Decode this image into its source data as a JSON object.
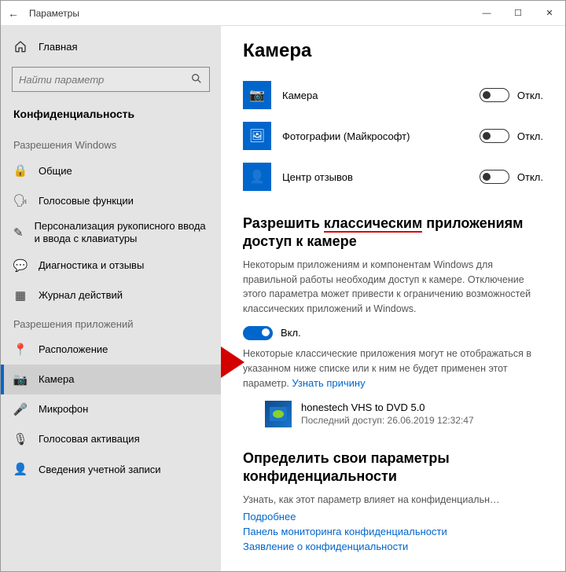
{
  "titlebar": {
    "title": "Параметры"
  },
  "sidebar": {
    "home": "Главная",
    "search_placeholder": "Найти параметр",
    "category": "Конфиденциальность",
    "sections": [
      {
        "header": "Разрешения Windows",
        "items": [
          {
            "icon": "lock-icon",
            "label": "Общие"
          },
          {
            "icon": "voice-icon",
            "label": "Голосовые функции"
          },
          {
            "icon": "pen-icon",
            "label": "Персонализация рукописного ввода и ввода с клавиатуры"
          },
          {
            "icon": "feedback-icon",
            "label": "Диагностика и отзывы"
          },
          {
            "icon": "activity-icon",
            "label": "Журнал действий"
          }
        ]
      },
      {
        "header": "Разрешения приложений",
        "items": [
          {
            "icon": "location-icon",
            "label": "Расположение"
          },
          {
            "icon": "camera-icon",
            "label": "Камера",
            "active": true
          },
          {
            "icon": "microphone-icon",
            "label": "Микрофон"
          },
          {
            "icon": "voice-activation-icon",
            "label": "Голосовая активация"
          },
          {
            "icon": "account-icon",
            "label": "Сведения учетной записи"
          }
        ]
      }
    ]
  },
  "main": {
    "page_title": "Камера",
    "apps": [
      {
        "name": "Камера",
        "state": "Откл.",
        "icon": "camera-app-icon"
      },
      {
        "name": "Фотографии (Майкрософт)",
        "state": "Откл.",
        "icon": "photos-app-icon"
      },
      {
        "name": "Центр отзывов",
        "state": "Откл.",
        "icon": "feedback-hub-icon"
      }
    ],
    "classic": {
      "heading_pre": "Разрешить ",
      "heading_underlined": "классическим",
      "heading_post": " приложениям доступ к камере",
      "desc": "Некоторым приложениям и компонентам Windows для правильной работы необходим доступ к камере. Отключение этого параметра может привести к ограничению возможностей классических приложений и Windows.",
      "toggle_state": "Вкл.",
      "note_pre": "Некоторые классические приложения могут не отображаться в указанном ниже списке или к ним не будет применен этот параметр. ",
      "note_link": "Узнать причину",
      "desktop_app": {
        "name": "honestech VHS to DVD 5.0",
        "sub": "Последний доступ: 26.06.2019 12:32:47"
      }
    },
    "privacy": {
      "heading": "Определить свои параметры конфиденциальности",
      "desc": "Узнать, как этот параметр влияет на конфиденциальн…",
      "links": [
        "Подробнее",
        "Панель мониторинга конфиденциальности",
        "Заявление о конфиденциальности"
      ]
    }
  }
}
